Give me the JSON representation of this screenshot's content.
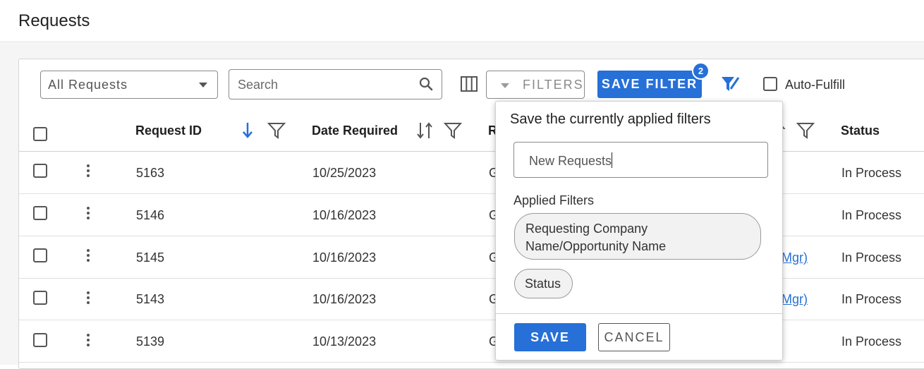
{
  "page": {
    "title": "Requests"
  },
  "toolbar": {
    "view_select": "All Requests",
    "search_placeholder": "Search",
    "filters_label": "FILTERS",
    "save_filter_label": "SAVE FILTER",
    "filter_count": "2",
    "auto_fulfill_label": "Auto-Fulfill"
  },
  "table": {
    "headers": {
      "request_id": "Request ID",
      "date_required": "Date Required",
      "partial_col": "R",
      "status": "Status"
    },
    "rows": [
      {
        "id": "5163",
        "date": "10/25/2023",
        "partial": "G",
        "link_fragment": "",
        "status": "In Process"
      },
      {
        "id": "5146",
        "date": "10/16/2023",
        "partial": "G",
        "link_fragment": "",
        "status": "In Process"
      },
      {
        "id": "5145",
        "date": "10/16/2023",
        "partial": "G",
        "link_fragment": "Mgr)",
        "status": "In Process"
      },
      {
        "id": "5143",
        "date": "10/16/2023",
        "partial": "G",
        "link_fragment": "Mgr)",
        "status": "In Process"
      },
      {
        "id": "5139",
        "date": "10/13/2023",
        "partial": "G",
        "link_fragment": "",
        "status": "In Process"
      }
    ]
  },
  "save_filter_popover": {
    "title": "Save the currently applied filters",
    "name_value": "New Requests",
    "applied_label": "Applied Filters",
    "chips": [
      "Requesting Company Name/Opportunity Name",
      "Status"
    ],
    "chip_1_line1": "Requesting Company",
    "chip_1_line2": "Name/Opportunity Name",
    "save_label": "SAVE",
    "cancel_label": "CANCEL"
  },
  "colors": {
    "primary": "#2670d8",
    "text": "#1f1f1f",
    "border": "#8a8a8a"
  }
}
